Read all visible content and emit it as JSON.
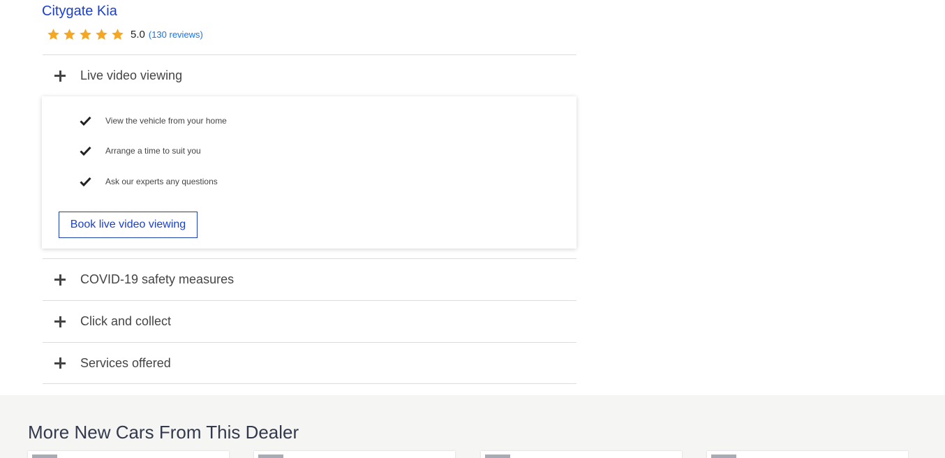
{
  "dealer": {
    "name": "Citygate Kia",
    "rating": "5.0",
    "reviews": "(130 reviews)",
    "stars": 5
  },
  "accordion": {
    "live_video": {
      "label": "Live video viewing",
      "features": [
        "View the vehicle from your home",
        "Arrange a time to suit you",
        "Ask our experts any questions"
      ],
      "button": "Book live video viewing"
    },
    "covid": {
      "label": "COVID-19 safety measures"
    },
    "click_collect": {
      "label": "Click and collect"
    },
    "services": {
      "label": "Services offered"
    }
  },
  "more_section": {
    "title": "More New Cars From This Dealer"
  },
  "colors": {
    "link": "#1a3fd0",
    "star": "#f5a623",
    "reviews_link": "#1a73e8"
  }
}
